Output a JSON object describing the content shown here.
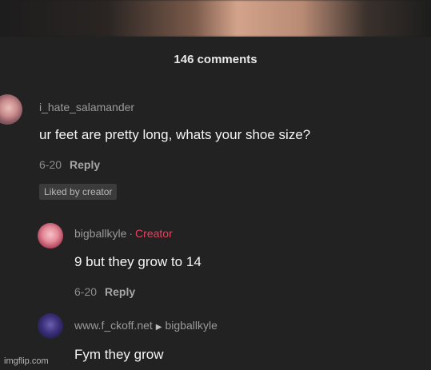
{
  "header": {
    "count_label": "146 comments"
  },
  "comments": [
    {
      "username": "i_hate_salamander",
      "text": "ur feet are pretty long, whats your shoe size?",
      "date": "6-20",
      "reply_label": "Reply",
      "liked_badge": "Liked by creator"
    },
    {
      "username": "bigballkyle",
      "role": "Creator",
      "text": "9 but they grow to 14",
      "date": "6-20",
      "reply_label": "Reply"
    },
    {
      "username": "www.f_ckoff.net",
      "reply_to": "bigballkyle",
      "text": "Fym they grow"
    }
  ],
  "watermark": "imgflip.com",
  "colors": {
    "creator": "#e4435f",
    "background": "#222222"
  }
}
